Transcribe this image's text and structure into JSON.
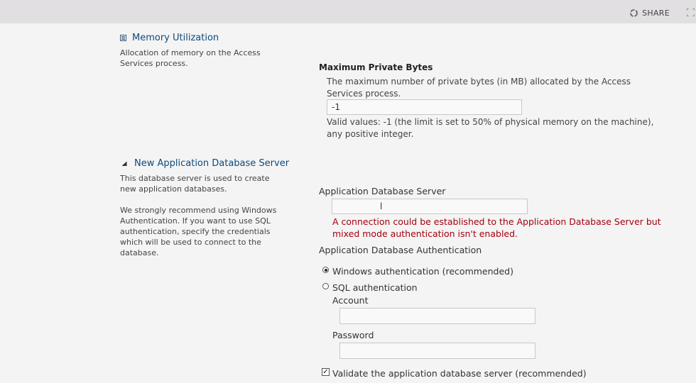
{
  "topbar": {
    "share_label": "SHARE"
  },
  "memory_section": {
    "title": "Memory Utilization",
    "description": "Allocation of memory on the Access Services process.",
    "field_title": "Maximum Private Bytes",
    "field_description": "The maximum number of private bytes (in MB) allocated by the Access Services process.",
    "value": "-1",
    "valid_values": "Valid values: -1 (the limit is set to 50% of physical memory on the machine), any positive integer."
  },
  "db_section": {
    "title": "New Application Database Server",
    "description_1": "This database server is used to create new application databases.",
    "description_2": "We strongly recommend using Windows Authentication. If you want to use SQL authentication, specify the credentials which will be used to connect to the database.",
    "server_label": "Application Database Server",
    "server_value": "                l",
    "error": "A connection could be established to the Application Database Server but mixed mode authentication isn't enabled.",
    "auth_label": "Application Database Authentication",
    "windows_auth": "Windows authentication (recommended)",
    "sql_auth": "SQL authentication",
    "account_label": "Account",
    "account_value": "",
    "password_label": "Password",
    "password_value": "",
    "validate_label": "Validate the application database server (recommended)"
  }
}
